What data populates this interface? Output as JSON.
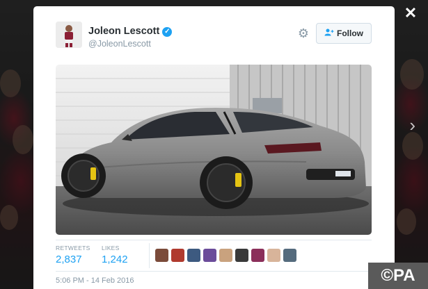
{
  "tweet": {
    "author_name": "Joleon Lescott",
    "author_handle": "@JoleonLescott",
    "verified": true,
    "follow_label": "Follow",
    "retweets_label": "RETWEETS",
    "retweets_count": "2,837",
    "likes_label": "LIKES",
    "likes_count": "1,242",
    "timestamp": "5:06 PM - 14 Feb 2016"
  },
  "likers": [
    "#7b4b3a",
    "#b03a2e",
    "#3d5a80",
    "#6b4c9a",
    "#c9a27e",
    "#3a3a3a",
    "#8b2f5a",
    "#d8b49a",
    "#556b7d"
  ],
  "controls": {
    "close": "✕",
    "next": "›"
  },
  "watermark": "©PA",
  "colors": {
    "accent": "#1da1f2",
    "text": "#292f33",
    "muted": "#8899a6"
  }
}
